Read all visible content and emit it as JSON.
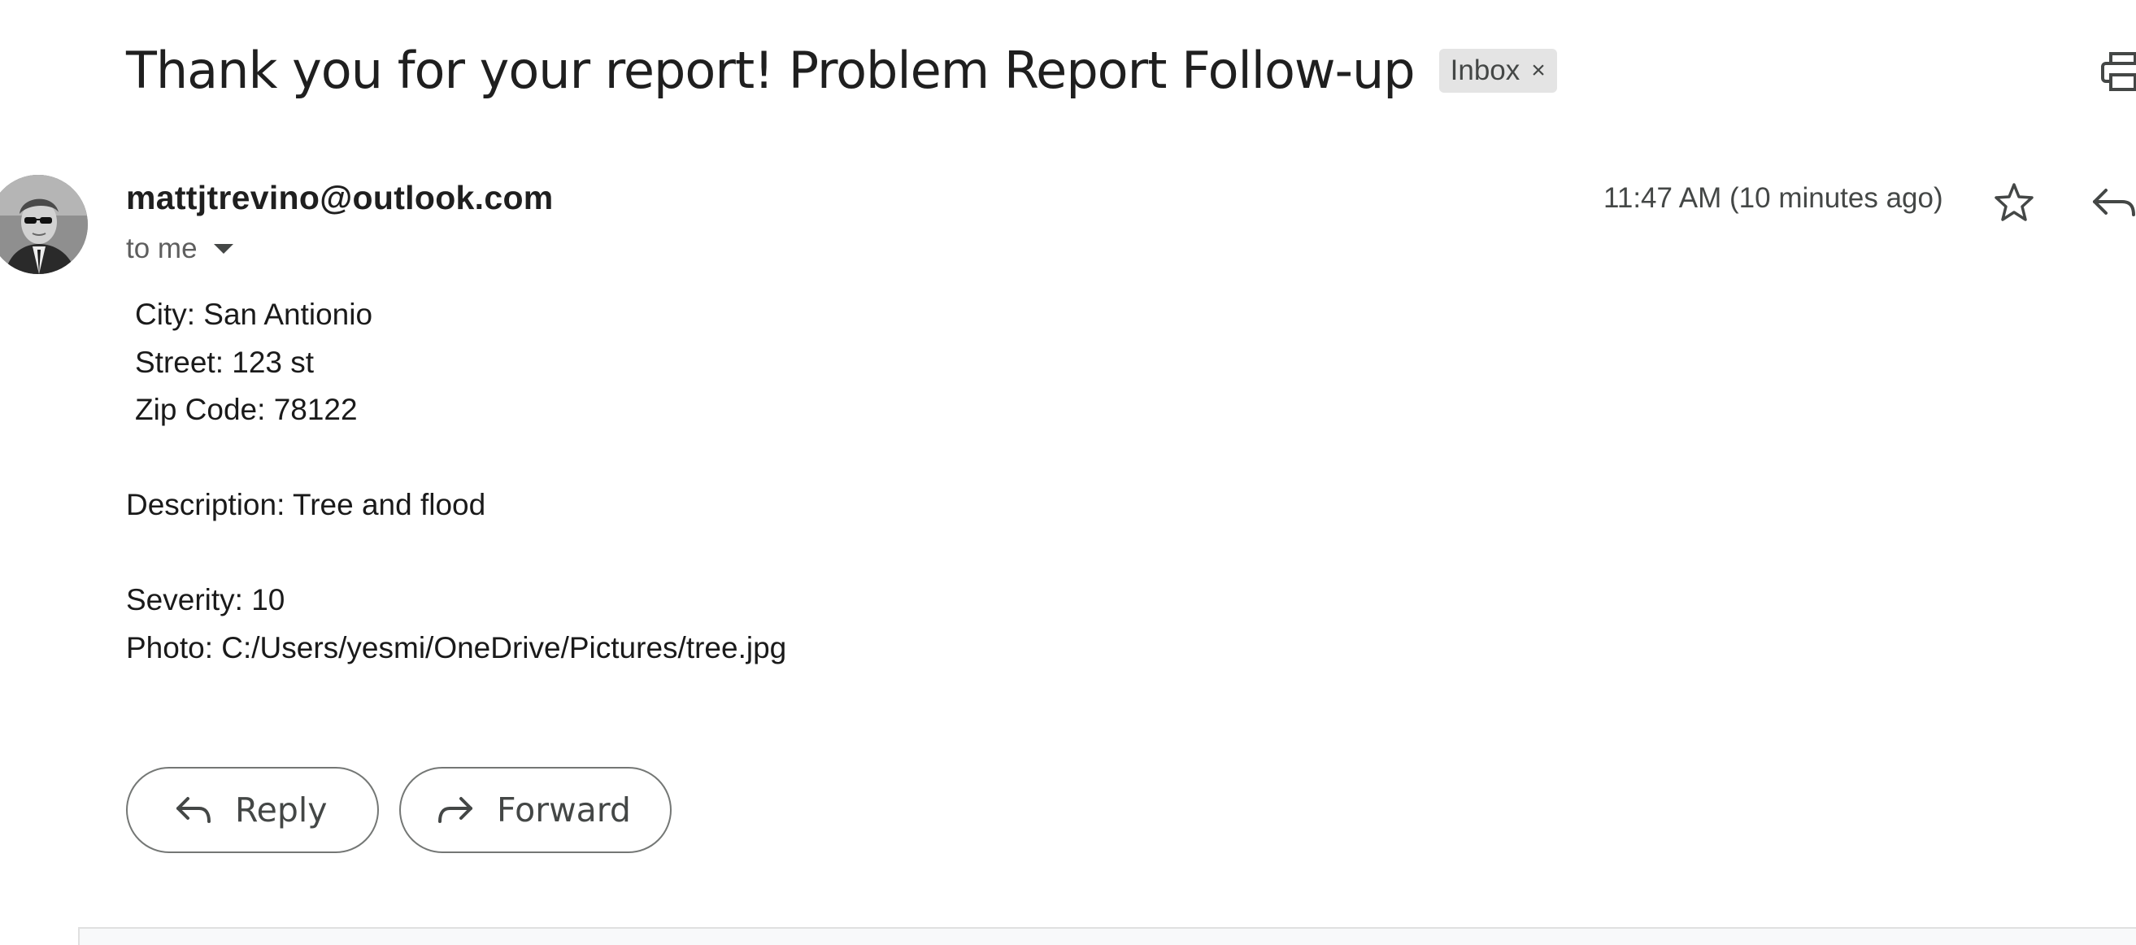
{
  "email": {
    "subject": "Thank you for your report! Problem Report Follow-up",
    "label": "Inbox",
    "label_remove": "×",
    "sender": "mattjtrevino@outlook.com",
    "recipient": "to me",
    "timestamp": "11:47 AM (10 minutes ago)",
    "body": {
      "city": "City: San Antionio",
      "street": "Street: 123 st",
      "zip": "Zip Code: 78122",
      "description": "Description: Tree and flood",
      "severity": "Severity: 10",
      "photo": "Photo: C:/Users/yesmi/OneDrive/Pictures/tree.jpg"
    }
  },
  "actions": {
    "reply_label": "Reply",
    "forward_label": "Forward"
  },
  "icons": {
    "print": "print-icon",
    "star": "star-icon",
    "reply": "reply-icon",
    "forward": "forward-icon",
    "expand": "chevron-down-icon"
  },
  "colors": {
    "chip_bg": "#e4e4e4",
    "button_border": "#747775",
    "secondary_text": "#444746"
  }
}
